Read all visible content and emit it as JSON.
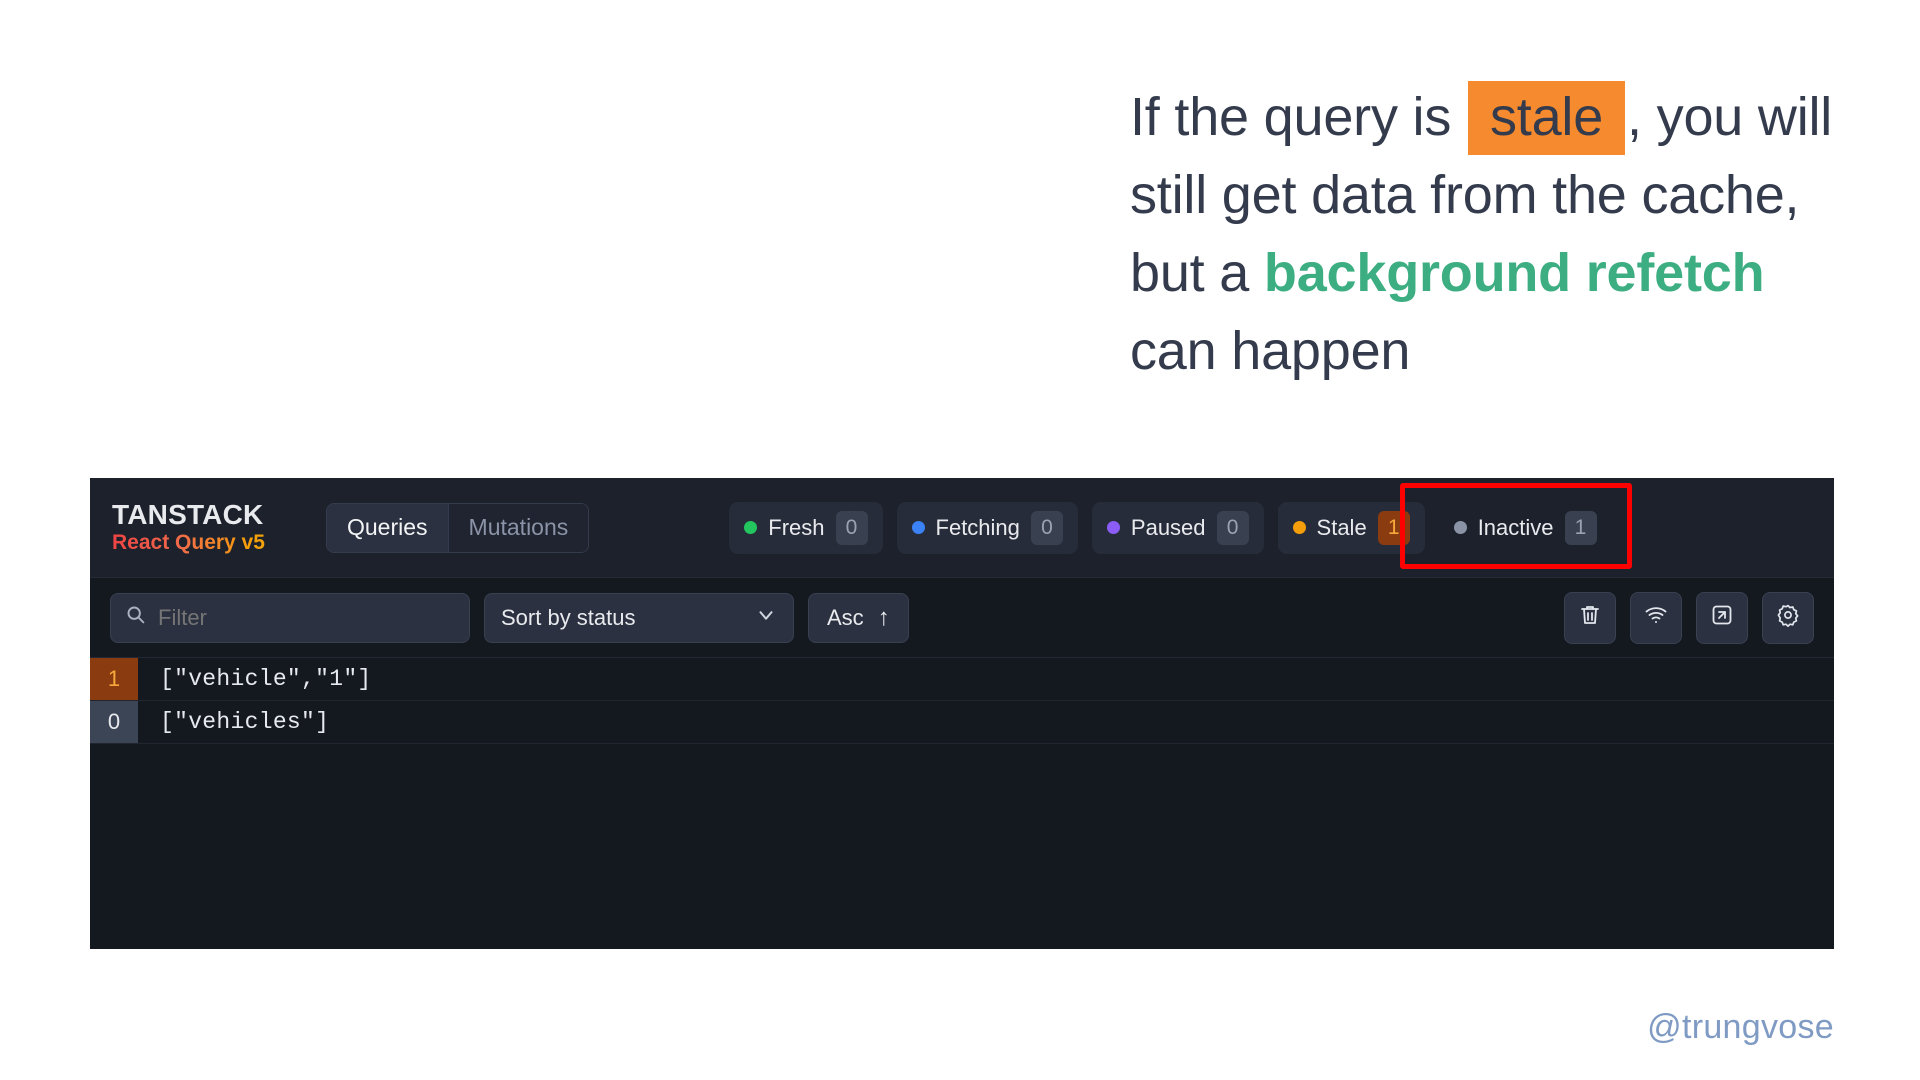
{
  "headline": {
    "part1": "If the query is ",
    "stale": "stale",
    "part2": ", you will still get data from the cache, but a ",
    "green": "background refetch",
    "part3": " can happen",
    "highlight_bg": "#F58A2E",
    "green_color": "#3DAE82",
    "text_color": "#343b4c"
  },
  "devtools": {
    "brand": {
      "top": "TANSTACK",
      "sub": "React Query v5"
    },
    "tabs": [
      {
        "label": "Queries",
        "active": true
      },
      {
        "label": "Mutations",
        "active": false
      }
    ],
    "status_badges": [
      {
        "label": "Fresh",
        "count": "0",
        "color": "#22c55e",
        "highlighted": false
      },
      {
        "label": "Fetching",
        "count": "0",
        "color": "#3b82f6",
        "highlighted": false
      },
      {
        "label": "Paused",
        "count": "0",
        "color": "#8b5cf6",
        "highlighted": false
      },
      {
        "label": "Stale",
        "count": "1",
        "color": "#f59e0b",
        "highlighted": true
      },
      {
        "label": "Inactive",
        "count": "1",
        "color": "#8b94a6",
        "highlighted": false
      }
    ],
    "highlight_color": "#ff0000",
    "toolbar": {
      "filter_placeholder": "Filter",
      "sort_label": "Sort by status",
      "order_label": "Asc",
      "order_arrow": "↑",
      "icons": [
        "trash-icon",
        "wifi-icon",
        "picture-in-picture-icon",
        "settings-icon"
      ]
    },
    "rows": [
      {
        "count": "1",
        "key": "[\"vehicle\",\"1\"]",
        "state": "stale"
      },
      {
        "count": "0",
        "key": "[\"vehicles\"]",
        "state": "inactive"
      }
    ]
  },
  "watermark": "@trungvose"
}
